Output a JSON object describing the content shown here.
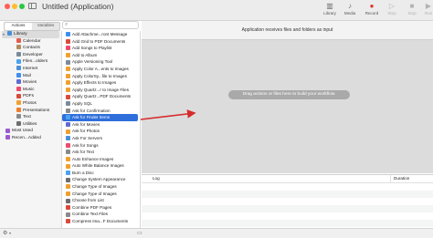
{
  "window": {
    "title": "Untitled (Application)"
  },
  "toolbar": [
    {
      "label": "Library",
      "icon": "▥",
      "enabled": true
    },
    {
      "label": "Media",
      "icon": "♪",
      "enabled": true
    },
    {
      "label": "Record",
      "icon": "●",
      "enabled": true,
      "color": "#e0322b"
    },
    {
      "label": "Step",
      "icon": "▷",
      "enabled": false
    },
    {
      "label": "Stop",
      "icon": "■",
      "enabled": false
    },
    {
      "label": "Run",
      "icon": "▶",
      "enabled": false
    }
  ],
  "tabs": {
    "actions": "Actions",
    "variables": "Variables"
  },
  "library": {
    "root": "Library",
    "children": [
      {
        "label": "Calendar",
        "color": "#e85a4f"
      },
      {
        "label": "Contacts",
        "color": "#b38b5d"
      },
      {
        "label": "Developer",
        "color": "#7b8a99"
      },
      {
        "label": "Files...olders",
        "color": "#4aa3f0"
      },
      {
        "label": "Internet",
        "color": "#4a90d9"
      },
      {
        "label": "Mail",
        "color": "#3d8ef0"
      },
      {
        "label": "Movies",
        "color": "#5f6bd1"
      },
      {
        "label": "Music",
        "color": "#f04a6a"
      },
      {
        "label": "PDFs",
        "color": "#d94a3a"
      },
      {
        "label": "Photos",
        "color": "#f0a030"
      },
      {
        "label": "Presentations",
        "color": "#f07d2a"
      },
      {
        "label": "Text",
        "color": "#8a8a8a"
      },
      {
        "label": "Utilities",
        "color": "#6d6d6d"
      }
    ],
    "special": [
      {
        "label": "Most Used",
        "color": "#9b59d0"
      },
      {
        "label": "Recen...Added",
        "color": "#9b59d0"
      }
    ]
  },
  "actions": [
    {
      "label": "Add Attachme...ront Message",
      "color": "#3d8ef0"
    },
    {
      "label": "Add Grid to PDF Documents",
      "color": "#d94a3a"
    },
    {
      "label": "Add Songs to Playlist",
      "color": "#f04a6a"
    },
    {
      "label": "Add to Album",
      "color": "#f0a030"
    },
    {
      "label": "Apple Versioning Tool",
      "color": "#7b8a99"
    },
    {
      "label": "Apply Color A...ents to Images",
      "color": "#f0a030"
    },
    {
      "label": "Apply ColorSy...file to Images",
      "color": "#f0a030"
    },
    {
      "label": "Apply Effects to Images",
      "color": "#f0a030"
    },
    {
      "label": "Apply Quartz...r to Image Files",
      "color": "#f0a030"
    },
    {
      "label": "Apply Quartz...PDF Documents",
      "color": "#d94a3a"
    },
    {
      "label": "Apply SQL",
      "color": "#7b8a99"
    },
    {
      "label": "Ask for Confirmation",
      "color": "#8a8a8a"
    },
    {
      "label": "Ask for Finder Items",
      "color": "#4aa3f0"
    },
    {
      "label": "Ask for Movies",
      "color": "#5f6bd1"
    },
    {
      "label": "Ask for Photos",
      "color": "#f0a030"
    },
    {
      "label": "Ask For Servers",
      "color": "#4a90d9"
    },
    {
      "label": "Ask for Songs",
      "color": "#f04a6a"
    },
    {
      "label": "Ask for Text",
      "color": "#8a8a8a"
    },
    {
      "label": "Auto Enhance Images",
      "color": "#f0a030"
    },
    {
      "label": "Auto White Balance Images",
      "color": "#f0a030"
    },
    {
      "label": "Burn a Disc",
      "color": "#4aa3f0"
    },
    {
      "label": "Change System Appearance",
      "color": "#6d6d6d"
    },
    {
      "label": "Change Type of Images",
      "color": "#f0a030"
    },
    {
      "label": "Change Type of Images",
      "color": "#f0a030"
    },
    {
      "label": "Choose from List",
      "color": "#6d6d6d"
    },
    {
      "label": "Combine PDF Pages",
      "color": "#d94a3a"
    },
    {
      "label": "Combine Text Files",
      "color": "#8a8a8a"
    },
    {
      "label": "Compress Ima...F Documents",
      "color": "#d94a3a"
    }
  ],
  "selected_action": "Ask for Finder Items",
  "workflow": {
    "header": "Application receives files and folders as input",
    "hint": "Drag actions or files here to build your workflow."
  },
  "log": {
    "col_log": "Log",
    "col_duration": "Duration"
  }
}
